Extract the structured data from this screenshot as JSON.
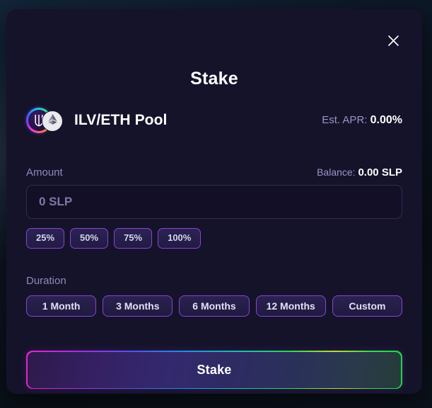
{
  "modal": {
    "title": "Stake",
    "close_label": "close-icon"
  },
  "pool": {
    "name": "ILV/ETH Pool",
    "primary_token_icon": "ilv-token-icon",
    "secondary_token_icon": "eth-token-icon",
    "apr_label": "Est. APR:",
    "apr_value": "0.00%"
  },
  "amount": {
    "label": "Amount",
    "balance_label": "Balance:",
    "balance_value": "0.00 SLP",
    "input_value": "",
    "input_placeholder": "0 SLP",
    "percent_options": [
      "25%",
      "50%",
      "75%",
      "100%"
    ]
  },
  "duration": {
    "label": "Duration",
    "options": [
      "1 Month",
      "3 Months",
      "6 Months",
      "12 Months",
      "Custom"
    ]
  },
  "submit": {
    "label": "Stake"
  },
  "colors": {
    "modal_background": "#15132a",
    "accent_purple": "#8b42d9",
    "muted_text": "#8f88ba",
    "value_text": "#ffffff",
    "input_background": "#120f26",
    "page_background": "#0d1726"
  }
}
